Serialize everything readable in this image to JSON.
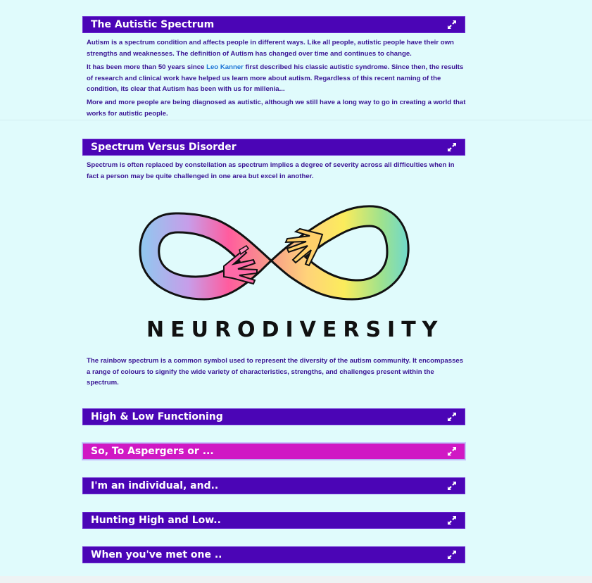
{
  "sections": {
    "autistic_spectrum": {
      "title": "The Autistic Spectrum",
      "p1": "Autism is a spectrum condition and affects people in different ways. Like all people, autistic people have their own strengths and weaknesses. The definition of Autism has changed over time and continues to change.",
      "p2_before": "It has been more than 50 years since ",
      "p2_link": "Leo Kanner",
      "p2_after": " first described his classic autistic syndrome. Since then, the results of research and clinical work have helped us learn more about autism. Regardless of this recent naming of the condition, its clear that Autism has been with us for millenia...",
      "p3": "More and more people are being diagnosed as autistic, although we still have a long way to go in creating a world that works for autistic people."
    },
    "spectrum_vs_disorder": {
      "title": "Spectrum Versus Disorder",
      "p1": "Spectrum is often replaced by constellation as spectrum implies a degree of severity across all difficulties when in fact a person may be quite challenged in one area but excel in another.",
      "image_text": "NEURODIVERSITY",
      "p2": "The rainbow spectrum is a common symbol used to represent the diversity of the autism community. It encompasses a range of colours to signify the wide variety of characteristics, strengths, and challenges present within the spectrum."
    },
    "collapsed": [
      {
        "title": "High & Low Functioning"
      },
      {
        "title": "So, To Aspergers or ..."
      },
      {
        "title": "I'm an individual, and.."
      },
      {
        "title": "Hunting High and Low.."
      },
      {
        "title": "When you've met one .."
      }
    ]
  },
  "colors": {
    "bar": "#4b05b6",
    "bar_active": "#d018c4",
    "background": "#e0fbfc",
    "text": "#3a1494",
    "link": "#1b74d6"
  },
  "icons": {
    "expand": "expand-arrows-icon"
  }
}
